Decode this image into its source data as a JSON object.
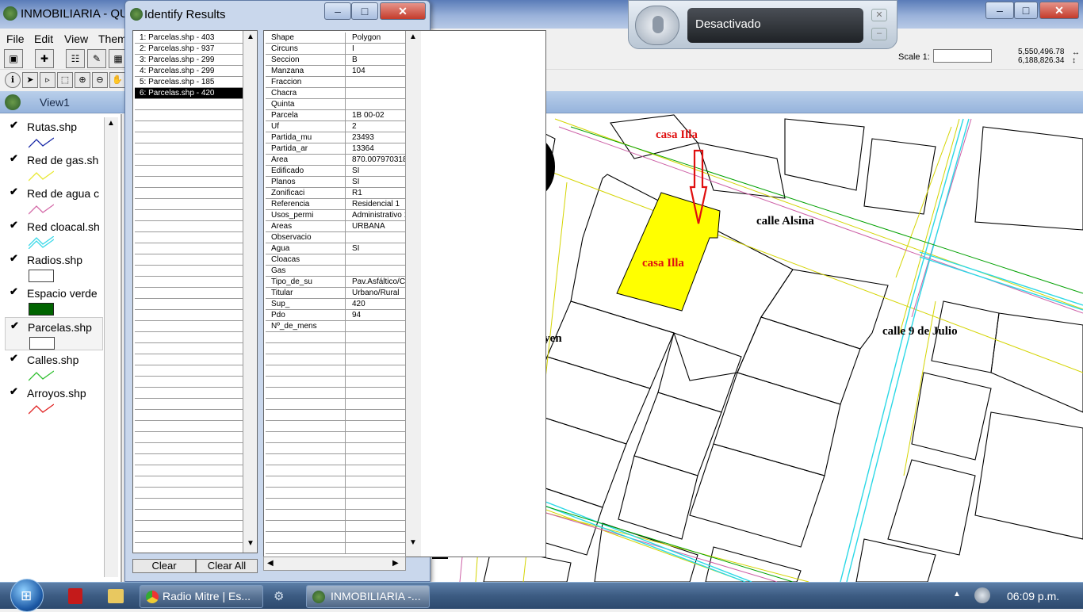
{
  "app": {
    "title": "INMOBILIARIA - QU"
  },
  "menu": [
    "File",
    "Edit",
    "View",
    "Them"
  ],
  "view": {
    "title": "View1",
    "scale_label": "Scale 1:",
    "scale_value": "",
    "coord_x": "5,550,496.78",
    "coord_y": "6,188,826.34"
  },
  "legend": {
    "layers": [
      {
        "name": "Rutas.shp",
        "color": "#1a2aa8",
        "symbol": "line"
      },
      {
        "name": "Red de gas.sh",
        "color": "#e8e830",
        "symbol": "line"
      },
      {
        "name": "Red de agua c",
        "color": "#d46aa8",
        "symbol": "line"
      },
      {
        "name": "Red cloacal.sh",
        "color": "#3ad8e8",
        "symbol": "double-line"
      },
      {
        "name": "Radios.shp",
        "color": "#ffffff",
        "symbol": "box"
      },
      {
        "name": "Espacio verde",
        "color": "#006400",
        "symbol": "box"
      },
      {
        "name": "Parcelas.shp",
        "color": "#ffffff",
        "symbol": "box"
      },
      {
        "name": "Calles.shp",
        "color": "#30c030",
        "symbol": "line"
      },
      {
        "name": "Arroyos.shp",
        "color": "#e02020",
        "symbol": "line"
      }
    ]
  },
  "identify": {
    "title": "Identify Results",
    "results": [
      "1:  Parcelas.shp - 403",
      "2:  Parcelas.shp - 937",
      "3:  Parcelas.shp - 299",
      "4:  Parcelas.shp - 299",
      "5:  Parcelas.shp - 185",
      "6:  Parcelas.shp - 420"
    ],
    "selected_index": 5,
    "attributes": [
      [
        "Shape",
        "Polygon"
      ],
      [
        "Circuns",
        "I"
      ],
      [
        "Seccion",
        "B"
      ],
      [
        "Manzana",
        "104"
      ],
      [
        "Fraccion",
        ""
      ],
      [
        "Chacra",
        ""
      ],
      [
        "Quinta",
        ""
      ],
      [
        "Parcela",
        "1B 00-02"
      ],
      [
        "Uf",
        "2"
      ],
      [
        "Partida_mu",
        "23493"
      ],
      [
        "Partida_ar",
        "13364"
      ],
      [
        "Area",
        "870.007970318"
      ],
      [
        "Edificado",
        "SI"
      ],
      [
        "Planos",
        "SI"
      ],
      [
        "Zonificaci",
        "R1"
      ],
      [
        "Referencia",
        "Residencial 1"
      ],
      [
        "Usos_permi",
        "Administrativo 1"
      ],
      [
        "Areas",
        "URBANA"
      ],
      [
        "Observacio",
        ""
      ],
      [
        "Agua",
        "SI"
      ],
      [
        "Cloacas",
        ""
      ],
      [
        "Gas",
        ""
      ],
      [
        "Tipo_de_su",
        "Pav.Asfáltico/C"
      ],
      [
        "Titular",
        "Urbano/Rural"
      ],
      [
        "Sup_",
        "420"
      ],
      [
        "Pdo",
        "94"
      ],
      [
        "Nº_de_mens",
        ""
      ]
    ],
    "clear_label": "Clear",
    "clear_all_label": "Clear All"
  },
  "map": {
    "labels": {
      "casa_top": "casa Illa",
      "casa_parcel": "casa Illa",
      "street_alsina": "calle Alsina",
      "street_irigoyen": "calle Bdo.Irigoyen",
      "street_9julio": "calle 9 de Julio"
    },
    "label_color": "#e01010",
    "highlight_color": "#ffff00"
  },
  "speech": {
    "status": "Desactivado"
  },
  "taskbar": {
    "tasks": [
      "Radio Mitre | Es...",
      "INMOBILIARIA -..."
    ],
    "clock": "06:09 p.m."
  }
}
